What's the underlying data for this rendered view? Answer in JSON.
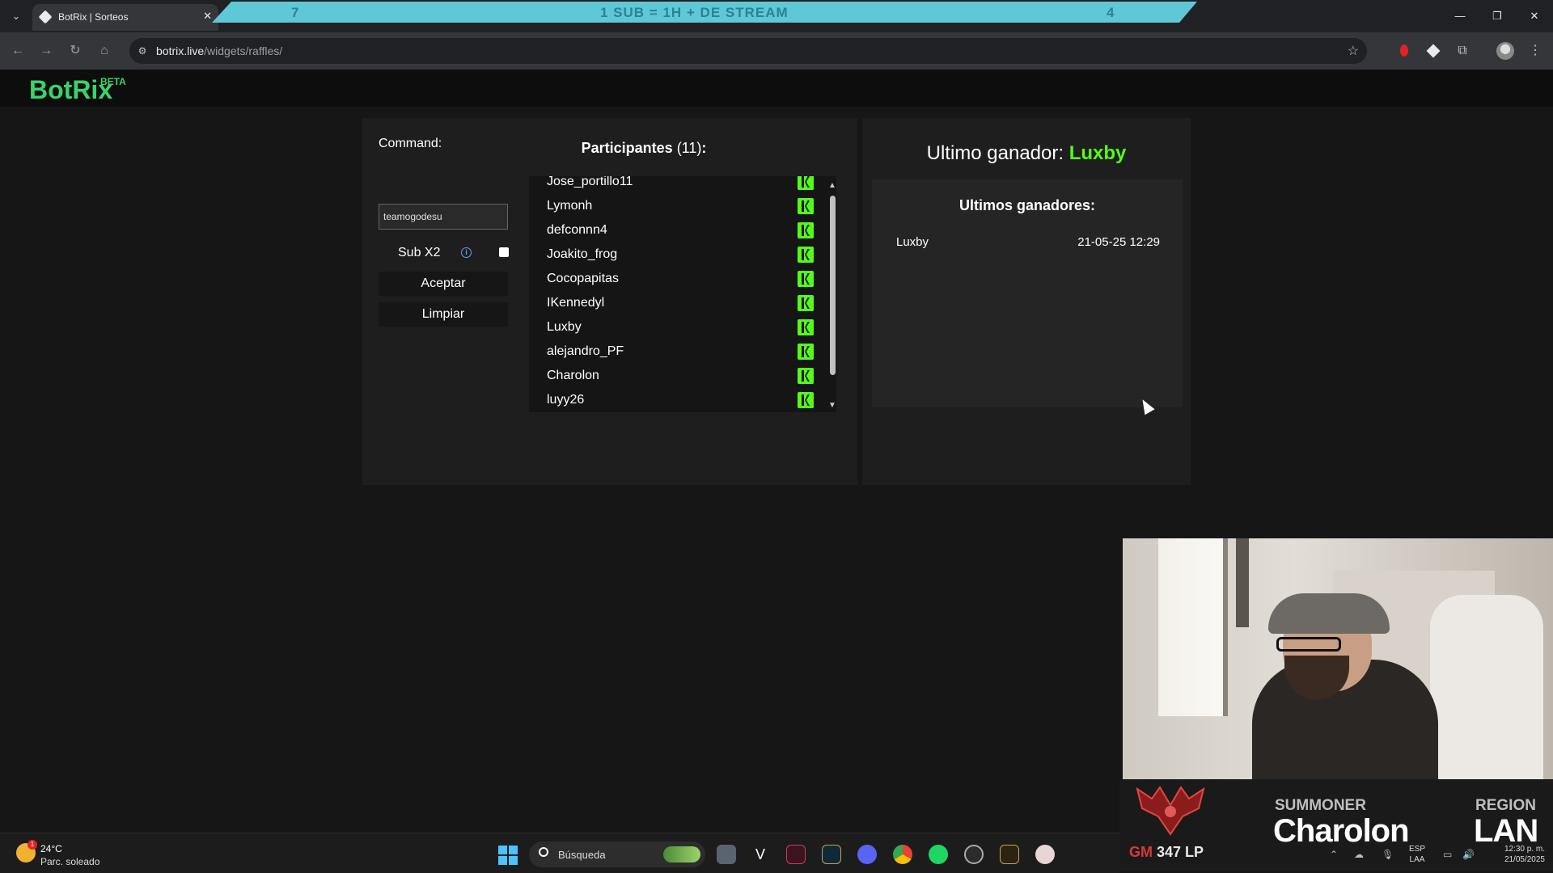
{
  "browser": {
    "tab_title": "BotRix | Sorteos",
    "url_domain": "botrix.live",
    "url_path": "/widgets/raffles/",
    "banner": {
      "left_number": "7",
      "text": "1 SUB = 1H + DE STREAM",
      "right_number": "4"
    }
  },
  "app": {
    "logo": "BotRix",
    "logo_badge": "BETA",
    "accent_color": "#53fc18"
  },
  "raffle": {
    "command_label": "Command:",
    "command_value": "teamogodesu",
    "sub_label": "Sub X2",
    "sub_checked": false,
    "accept_label": "Aceptar",
    "clear_label": "Limpiar",
    "participants_label": "Participantes",
    "participants_count": "(11)",
    "participants_suffix": ":",
    "participants": [
      {
        "name": "Jose_portillo11",
        "platform_icon": "kick-icon"
      },
      {
        "name": "Lymonh",
        "platform_icon": "kick-icon"
      },
      {
        "name": "defconnn4",
        "platform_icon": "kick-icon"
      },
      {
        "name": "Joakito_frog",
        "platform_icon": "kick-icon"
      },
      {
        "name": "Cocopapitas",
        "platform_icon": "kick-icon"
      },
      {
        "name": "IKennedyl",
        "platform_icon": "kick-icon"
      },
      {
        "name": "Luxby",
        "platform_icon": "kick-icon"
      },
      {
        "name": "alejandro_PF",
        "platform_icon": "kick-icon"
      },
      {
        "name": "Charolon",
        "platform_icon": "kick-icon"
      },
      {
        "name": "luyy26",
        "platform_icon": "kick-icon"
      }
    ]
  },
  "winners": {
    "last_winner_label": "Ultimo ganador:",
    "last_winner_name": "Luxby",
    "history_title": "Ultimos ganadores:",
    "history": [
      {
        "name": "Luxby",
        "date": "21-05-25 12:29"
      }
    ]
  },
  "stream_overlay": {
    "rank_tier": "GM",
    "rank_lp": "347 LP",
    "summoner_label": "SUMMONER",
    "summoner_name": "Charolon",
    "region_label": "REGION",
    "region_value": "LAN"
  },
  "taskbar": {
    "weather_badge": "1",
    "weather_temp": "24°C",
    "weather_desc": "Parc. soleado",
    "search_placeholder": "Búsqueda",
    "lang_line1": "ESP",
    "lang_line2": "LAA",
    "time": "12:30 p. m.",
    "date": "21/05/2025"
  }
}
